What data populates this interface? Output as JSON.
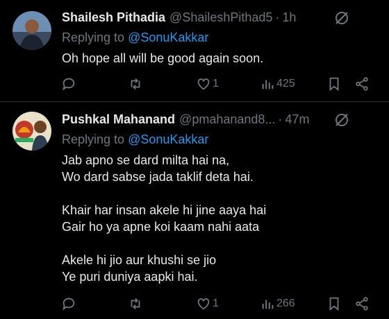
{
  "tweets": [
    {
      "name": "Shailesh Pithadia",
      "handle": "@ShaileshPithad5",
      "dot": "·",
      "time": "1h",
      "replying_prefix": "Replying to",
      "replying_to": "@SonuKakkar",
      "lines": [
        "Oh hope all will be good again soon."
      ],
      "likes": "1",
      "views": "425",
      "icons": [
        "grok-icon",
        "reply-icon",
        "retweet-icon",
        "like-icon",
        "views-icon",
        "bookmark-icon",
        "share-icon"
      ]
    },
    {
      "name": "Pushkal Mahanand",
      "handle": "@pmahanand8...",
      "dot": "·",
      "time": "47m",
      "replying_prefix": "Replying to",
      "replying_to": "@SonuKakkar",
      "lines": [
        "Jab apno se dard milta hai na,",
        "Wo dard sabse jada taklif deta hai.",
        "",
        "Khair har insan akele hi jine aaya hai",
        "Gair ho ya apne koi kaam nahi aata",
        "",
        "Akele hi jio aur khushi se jio",
        "Ye puri duniya aapki hai."
      ],
      "likes": "1",
      "views": "266",
      "icons": [
        "grok-icon",
        "reply-icon",
        "retweet-icon",
        "like-icon",
        "views-icon",
        "bookmark-icon",
        "share-icon"
      ]
    }
  ],
  "colors": {
    "background": "#000000",
    "text": "#e7e9ea",
    "muted": "#71767b",
    "link": "#1d9bf0",
    "divider": "#2f3336"
  }
}
